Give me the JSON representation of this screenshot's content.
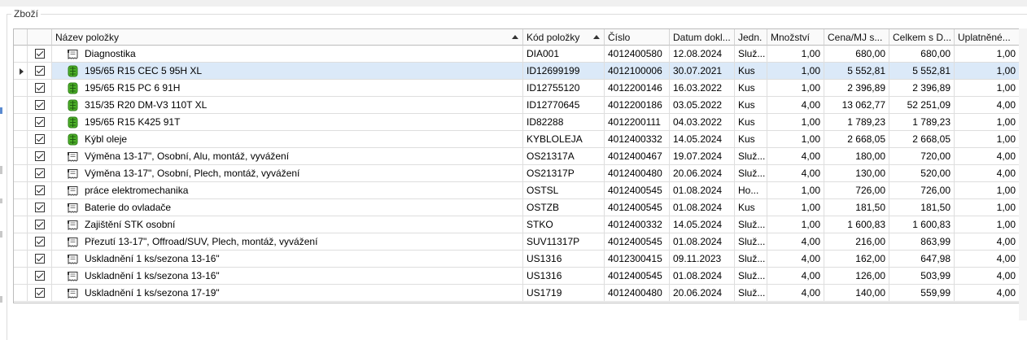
{
  "group": {
    "title": "Zboží"
  },
  "table": {
    "columns": [
      "",
      "Název položky",
      "Kód položky",
      "Číslo",
      "Datum dokl...",
      "Jedn.",
      "Množství",
      "Cena/MJ s...",
      "Celkem s D...",
      "Uplatněné..."
    ],
    "sorted_columns": [
      "Název položky",
      "Kód položky"
    ],
    "selected_row": 1,
    "rows": [
      {
        "icon": "service-icon",
        "name": "Diagnostika",
        "code": "DIA001",
        "number": "4012400580",
        "date": "12.08.2024",
        "unit": "Služ...",
        "qty": "1,00",
        "price": "680,00",
        "total": "680,00",
        "applied": "1,00"
      },
      {
        "icon": "tire-icon",
        "name": "195/65 R15 CEC 5 95H XL",
        "code": "ID12699199",
        "number": "4012100006",
        "date": "30.07.2021",
        "unit": "Kus",
        "qty": "1,00",
        "price": "5 552,81",
        "total": "5 552,81",
        "applied": "1,00"
      },
      {
        "icon": "tire-icon",
        "name": "195/65 R15 PC 6 91H",
        "code": "ID12755120",
        "number": "4012200146",
        "date": "16.03.2022",
        "unit": "Kus",
        "qty": "1,00",
        "price": "2 396,89",
        "total": "2 396,89",
        "applied": "1,00"
      },
      {
        "icon": "tire-icon",
        "name": "315/35 R20 DM-V3 110T XL",
        "code": "ID12770645",
        "number": "4012200186",
        "date": "03.05.2022",
        "unit": "Kus",
        "qty": "4,00",
        "price": "13 062,77",
        "total": "52 251,09",
        "applied": "4,00"
      },
      {
        "icon": "tire-icon",
        "name": "195/65 R15 K425 91T",
        "code": "ID82288",
        "number": "4012200111",
        "date": "04.03.2022",
        "unit": "Kus",
        "qty": "1,00",
        "price": "1 789,23",
        "total": "1 789,23",
        "applied": "1,00"
      },
      {
        "icon": "tire-icon",
        "name": "Kýbl oleje",
        "code": "KYBLOLEJA",
        "number": "4012400332",
        "date": "14.05.2024",
        "unit": "Kus",
        "qty": "1,00",
        "price": "2 668,05",
        "total": "2 668,05",
        "applied": "1,00"
      },
      {
        "icon": "service-icon",
        "name": "Výměna 13-17\", Osobní, Alu, montáž, vyvážení",
        "code": "OS21317A",
        "number": "4012400467",
        "date": "19.07.2024",
        "unit": "Služ...",
        "qty": "4,00",
        "price": "180,00",
        "total": "720,00",
        "applied": "4,00"
      },
      {
        "icon": "service-icon",
        "name": "Výměna 13-17\", Osobní, Plech, montáž, vyvážení",
        "code": "OS21317P",
        "number": "4012400480",
        "date": "20.06.2024",
        "unit": "Služ...",
        "qty": "4,00",
        "price": "130,00",
        "total": "520,00",
        "applied": "4,00"
      },
      {
        "icon": "service-icon",
        "name": "práce elektromechanika",
        "code": "OSTSL",
        "number": "4012400545",
        "date": "01.08.2024",
        "unit": "Ho...",
        "qty": "1,00",
        "price": "726,00",
        "total": "726,00",
        "applied": "1,00"
      },
      {
        "icon": "service-icon",
        "name": "Baterie do ovladače",
        "code": "OSTZB",
        "number": "4012400545",
        "date": "01.08.2024",
        "unit": "Kus",
        "qty": "1,00",
        "price": "181,50",
        "total": "181,50",
        "applied": "1,00"
      },
      {
        "icon": "service-icon",
        "name": "Zajištění STK osobní",
        "code": "STKO",
        "number": "4012400332",
        "date": "14.05.2024",
        "unit": "Služ...",
        "qty": "1,00",
        "price": "1 600,83",
        "total": "1 600,83",
        "applied": "1,00"
      },
      {
        "icon": "service-icon",
        "name": "Přezutí 13-17\", Offroad/SUV, Plech, montáž, vyvážení",
        "code": "SUV11317P",
        "number": "4012400545",
        "date": "01.08.2024",
        "unit": "Služ...",
        "qty": "4,00",
        "price": "216,00",
        "total": "863,99",
        "applied": "4,00"
      },
      {
        "icon": "service-icon",
        "name": "Uskladnění 1 ks/sezona 13-16\"",
        "code": "US1316",
        "number": "4012300415",
        "date": "09.11.2023",
        "unit": "Služ...",
        "qty": "4,00",
        "price": "162,00",
        "total": "647,98",
        "applied": "4,00"
      },
      {
        "icon": "service-icon",
        "name": "Uskladnění 1 ks/sezona 13-16\"",
        "code": "US1316",
        "number": "4012400545",
        "date": "01.08.2024",
        "unit": "Služ...",
        "qty": "4,00",
        "price": "126,00",
        "total": "503,99",
        "applied": "4,00"
      },
      {
        "icon": "service-icon",
        "name": "Uskladnění 1 ks/sezona 17-19\"",
        "code": "US1719",
        "number": "4012400480",
        "date": "20.06.2024",
        "unit": "Služ...",
        "qty": "4,00",
        "price": "140,00",
        "total": "559,99",
        "applied": "4,00"
      }
    ]
  },
  "colors": {
    "selection": "#dbe9f8",
    "tire_icon": "#4caf28",
    "grid_line": "#dedede"
  }
}
